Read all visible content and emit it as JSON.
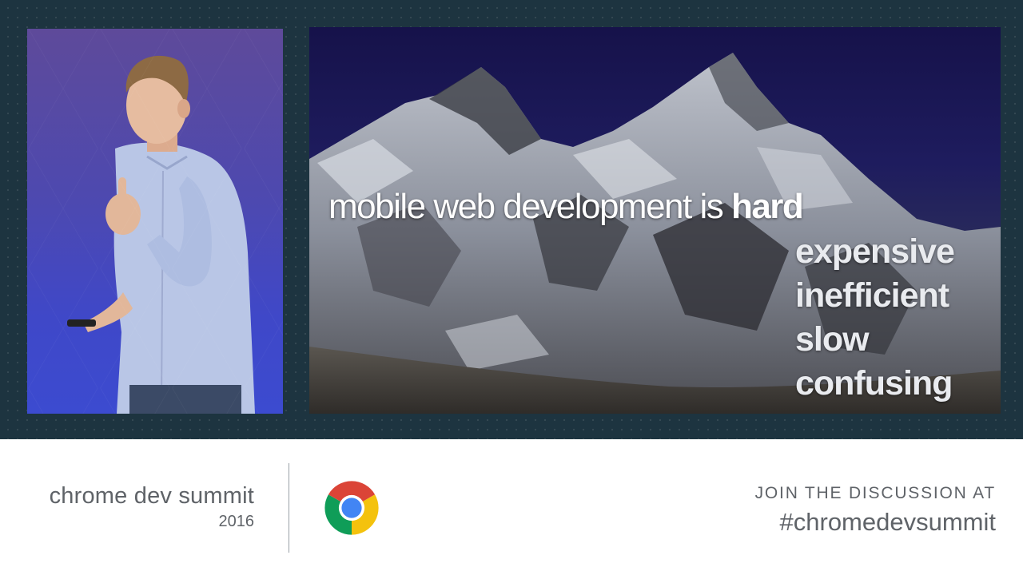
{
  "slide": {
    "title_prefix": "mobile web development is ",
    "title_emphasis": "hard",
    "adjectives": [
      "expensive",
      "inefficient",
      "slow",
      "confusing"
    ]
  },
  "footer": {
    "brand_name": "chrome dev summit",
    "brand_year": "2016",
    "cta": "JOIN THE DISCUSSION AT",
    "hashtag": "#chromedevsummit"
  },
  "colors": {
    "frame": "#1d3440",
    "slide_sky": "#16124a",
    "footer_text": "#5f6368",
    "chrome_red": "#db4437",
    "chrome_yellow": "#f4c20d",
    "chrome_green": "#0f9d58",
    "chrome_blue": "#4285f4"
  },
  "icons": [
    "chrome-logo-icon"
  ]
}
